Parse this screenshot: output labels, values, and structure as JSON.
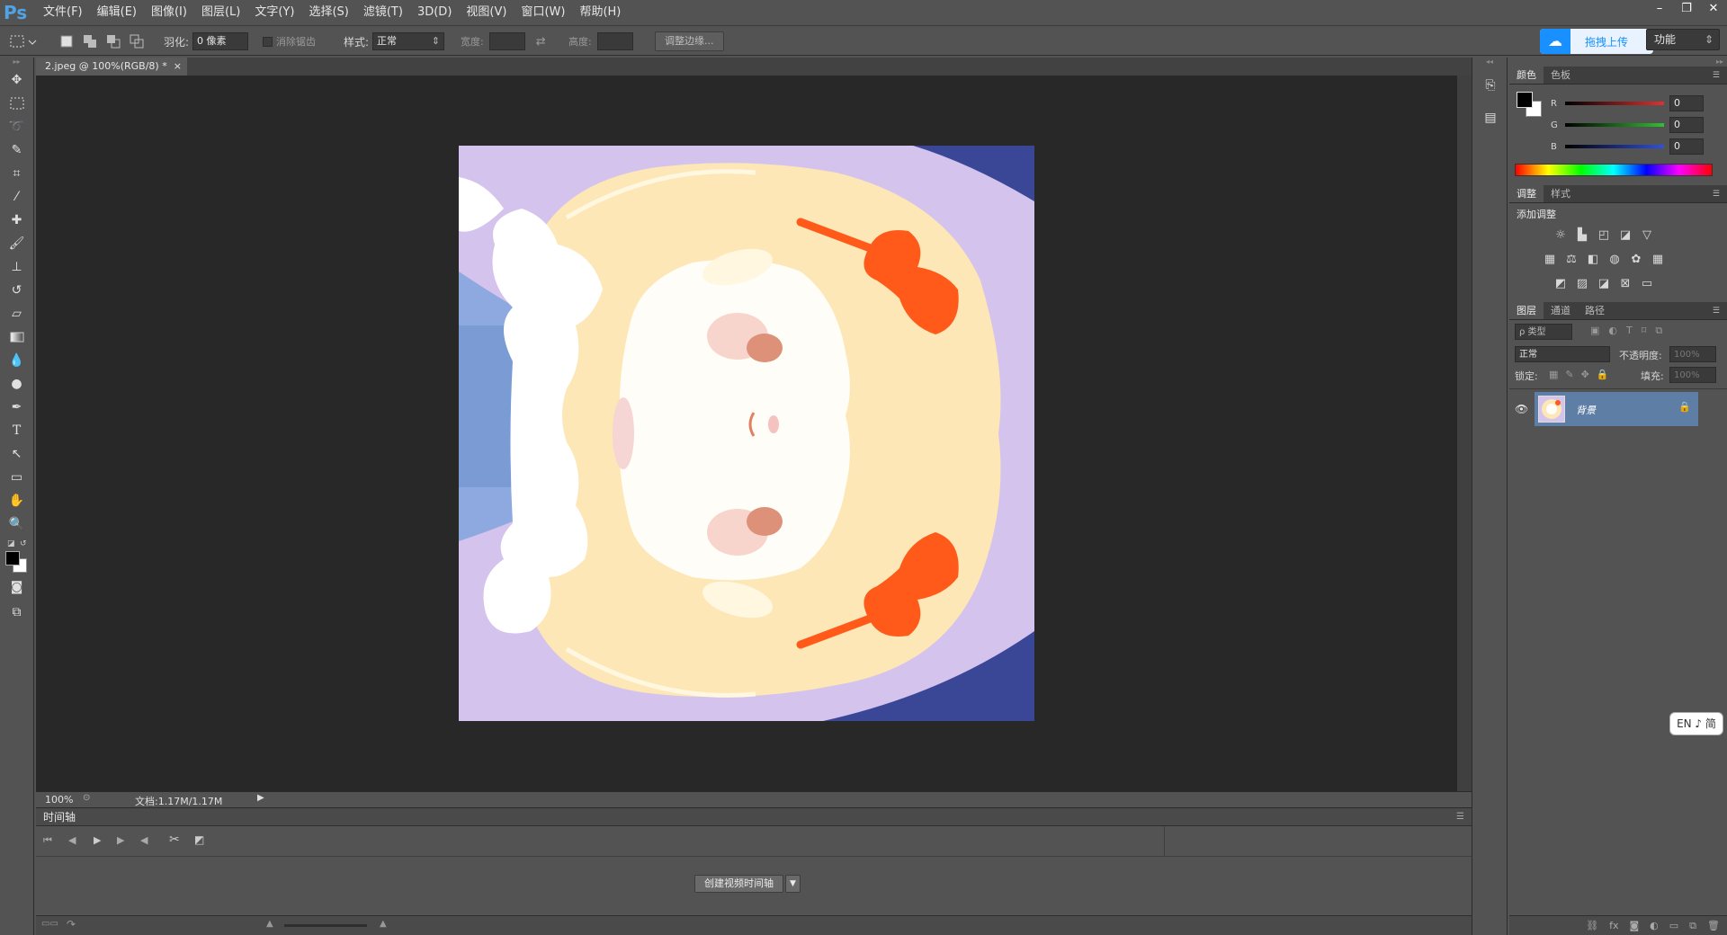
{
  "app": {
    "logo": "Ps"
  },
  "menu": [
    "文件(F)",
    "编辑(E)",
    "图像(I)",
    "图层(L)",
    "文字(Y)",
    "选择(S)",
    "滤镜(T)",
    "3D(D)",
    "视图(V)",
    "窗口(W)",
    "帮助(H)"
  ],
  "window_controls": [
    "–",
    "❐",
    "✕"
  ],
  "options": {
    "feather_label": "羽化:",
    "feather_value": "0 像素",
    "antialias_label": "消除锯齿",
    "style_label": "样式:",
    "style_value": "正常",
    "width_label": "宽度:",
    "height_label": "高度:",
    "refine_edge": "调整边缘...",
    "workspace_value": "功能"
  },
  "upload": {
    "label": "拖拽上传"
  },
  "document": {
    "tab_title": "2.jpeg @ 100%(RGB/8) *",
    "close": "×"
  },
  "status": {
    "zoom": "100%",
    "doc_size": "文档:1.17M/1.17M"
  },
  "timeline": {
    "title": "时间轴",
    "create_button": "创建视频时间轴"
  },
  "color_panel": {
    "tabs": [
      "颜色",
      "色板"
    ],
    "channels": [
      {
        "label": "R",
        "value": "0",
        "color": "#e03030"
      },
      {
        "label": "G",
        "value": "0",
        "color": "#30c030"
      },
      {
        "label": "B",
        "value": "0",
        "color": "#3050e0"
      }
    ]
  },
  "adjust_panel": {
    "tabs": [
      "调整",
      "样式"
    ],
    "title": "添加调整"
  },
  "layers_panel": {
    "tabs": [
      "图层",
      "通道",
      "路径"
    ],
    "filter_label": "ρ 类型",
    "blend_mode": "正常",
    "opacity_label": "不透明度:",
    "opacity_value": "100%",
    "lock_label": "锁定:",
    "fill_label": "填充:",
    "fill_value": "100%",
    "layers": [
      {
        "name": "背景",
        "visible": true,
        "locked": true
      }
    ]
  },
  "ime": {
    "label": "EN ♪ 简"
  }
}
